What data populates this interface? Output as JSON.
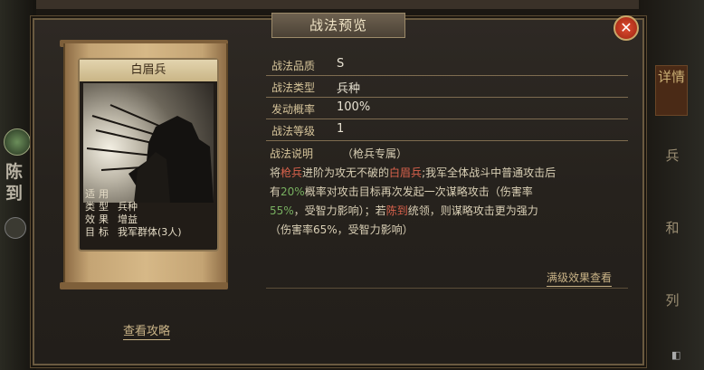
{
  "panel_title": "战法预览",
  "close_icon": "close-icon",
  "card": {
    "title": "白眉兵",
    "info": [
      {
        "key": "适用",
        "value": ""
      },
      {
        "key": "类型",
        "value": "兵种"
      },
      {
        "key": "效果",
        "value": "增益"
      },
      {
        "key": "目标",
        "value": "我军群体(3人)"
      }
    ]
  },
  "guide_link": "查看攻略",
  "attributes": [
    {
      "key": "战法品质",
      "value": "S"
    },
    {
      "key": "战法类型",
      "value": "兵种"
    },
    {
      "key": "发动概率",
      "value": "100%"
    },
    {
      "key": "战法等级",
      "value": "1"
    }
  ],
  "description": {
    "key": "战法说明",
    "note": "（枪兵专属）",
    "segments": [
      {
        "text": "将",
        "color": "normal"
      },
      {
        "text": "枪兵",
        "color": "red"
      },
      {
        "text": "进阶为攻无不破的",
        "color": "normal"
      },
      {
        "text": "白眉兵",
        "color": "red"
      },
      {
        "text": ";我军全体战斗中普通攻击后",
        "color": "normal"
      },
      {
        "text": "有",
        "color": "normal"
      },
      {
        "text": "20%",
        "color": "green"
      },
      {
        "text": "概率对攻击目标再次发起一次谋略攻击（伤害率",
        "color": "normal"
      },
      {
        "text": "55%",
        "color": "green"
      },
      {
        "text": "，受智力影响）；若",
        "color": "normal"
      },
      {
        "text": "陈到",
        "color": "red"
      },
      {
        "text": "统领，则谋略攻击更为强力",
        "color": "normal"
      },
      {
        "text": "（伤害率65%，受智力影响）",
        "color": "normal"
      }
    ],
    "lines": [
      [
        0,
        4
      ],
      [
        5,
        7
      ],
      [
        8,
        11
      ],
      [
        12,
        12
      ]
    ]
  },
  "max_effect_link": "满级效果查看",
  "side_left": {
    "text": "陈到"
  },
  "side_right_tabs": [
    "详情",
    "兵",
    "和",
    "列"
  ],
  "colors": {
    "red": "#d9624c",
    "green": "#78b060"
  }
}
